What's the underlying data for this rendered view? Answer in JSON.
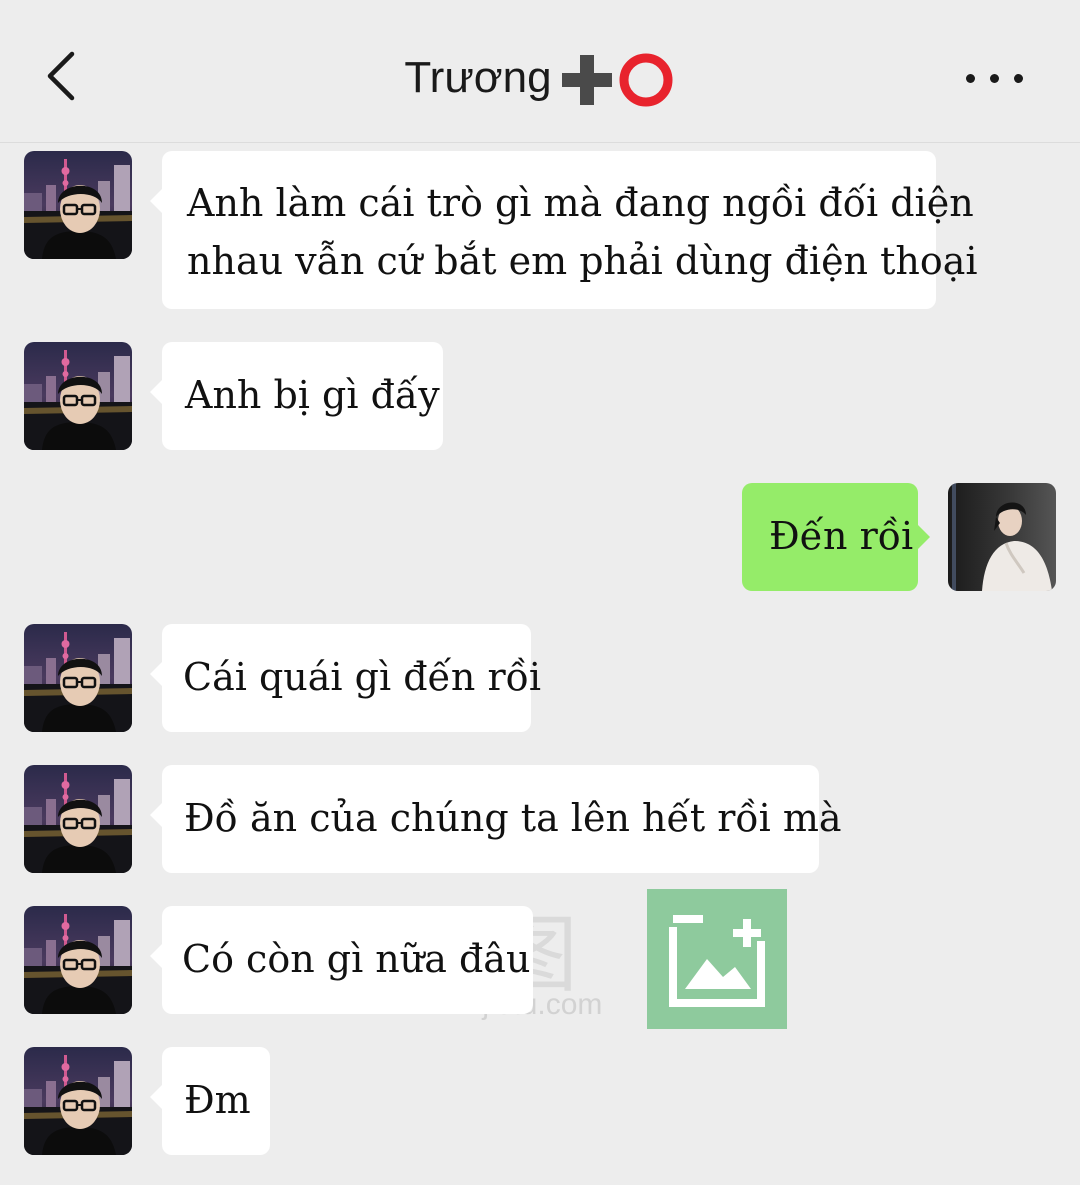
{
  "header": {
    "title": "Trương",
    "title_emojis": "➕⭕",
    "back_icon": "chevron-left-icon",
    "more_icon": "more-dots-icon"
  },
  "messages": [
    {
      "side": "in",
      "lines": [
        "Anh làm cái trò gì mà đang ngồi đối diện",
        "nhau vẫn cứ bắt em phải dùng điện thoại"
      ]
    },
    {
      "side": "in",
      "lines": [
        "Anh bị gì đấy"
      ]
    },
    {
      "side": "out",
      "lines": [
        "Đến rồi"
      ]
    },
    {
      "side": "in",
      "lines": [
        "Cái quái gì đến rồi"
      ]
    },
    {
      "side": "in",
      "lines": [
        "Đồ ăn của chúng ta lên hết rồi mà"
      ]
    },
    {
      "side": "in",
      "lines": [
        "Có còn gì nữa đâu"
      ]
    },
    {
      "side": "in",
      "lines": [
        "Đm"
      ]
    }
  ],
  "watermark": {
    "text": "ᵂᵃᶦ图",
    "url": "www.wjietu.com"
  },
  "colors": {
    "background": "#ededed",
    "incoming_bubble": "#ffffff",
    "outgoing_bubble": "#95ec69"
  }
}
